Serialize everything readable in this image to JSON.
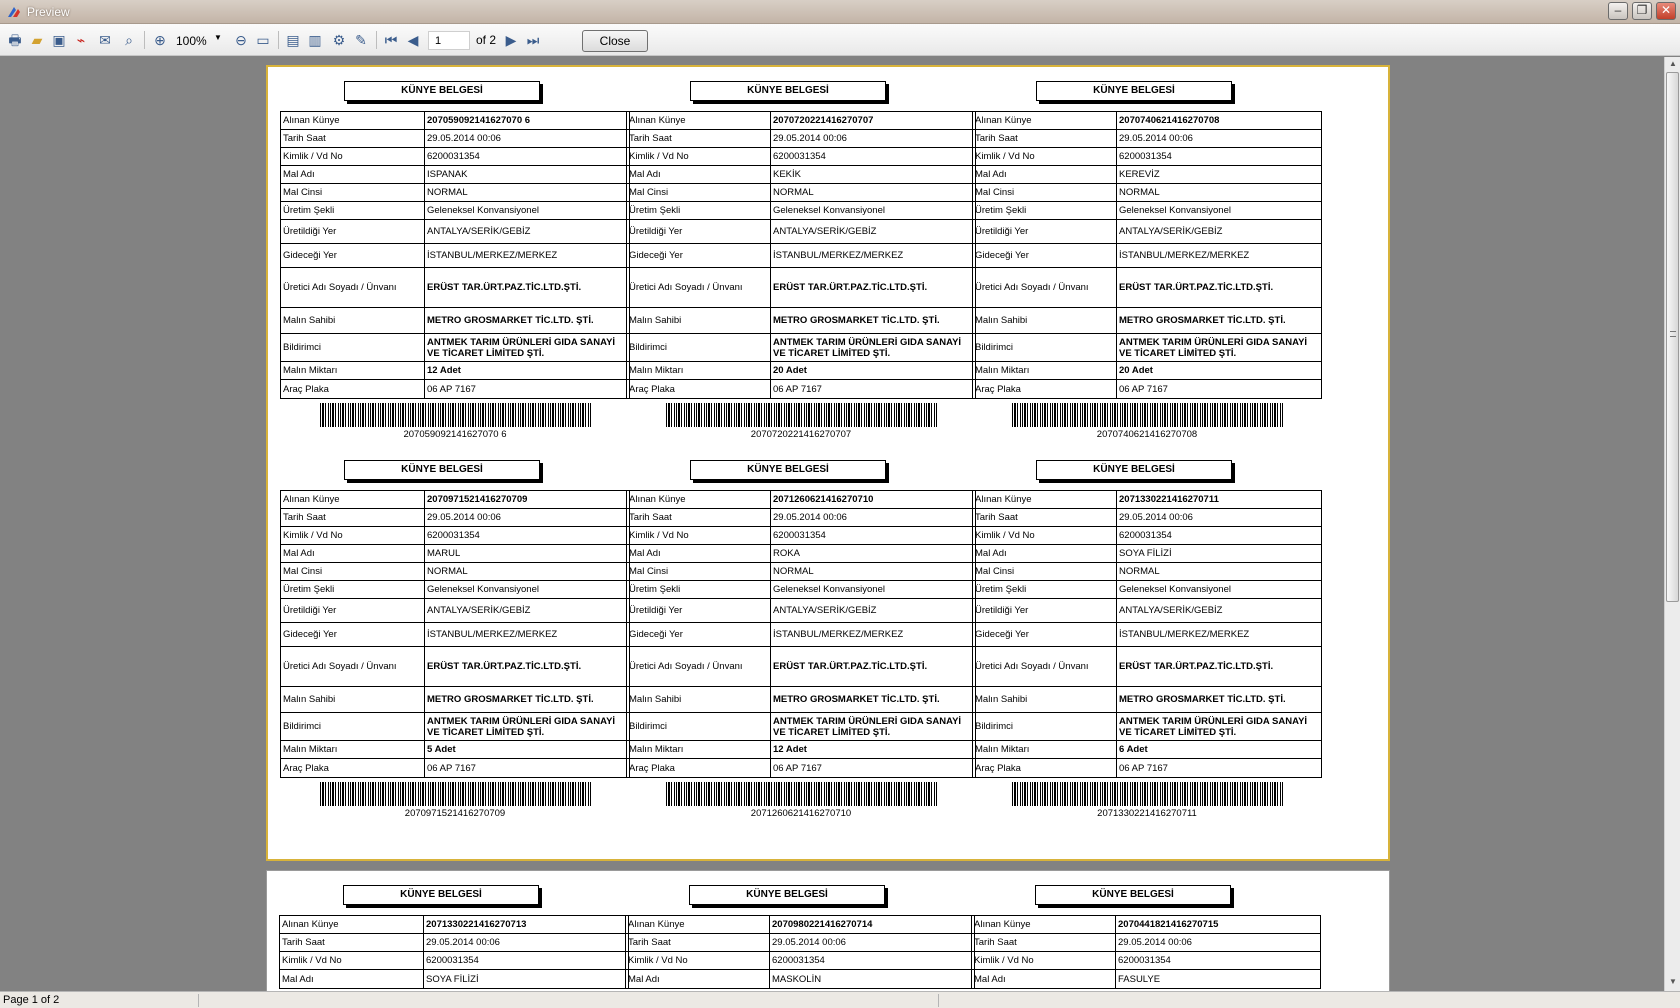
{
  "window": {
    "title": "Preview"
  },
  "toolbar": {
    "zoom": "100%",
    "page_value": "1",
    "page_of": "of 2",
    "close_label": "Close"
  },
  "status": {
    "text": "Page 1 of 2"
  },
  "labels": [
    "Alınan Künye",
    "Tarih Saat",
    "Kimlik / Vd No",
    "Mal Adı",
    "Mal Cinsi",
    "Üretim Şekli",
    "Üretildiği Yer",
    "Gideceği Yer",
    "Üretici Adı Soyadı / Ünvanı",
    "Malın Sahibi",
    "Bildirimci",
    "Malın Miktarı",
    "Araç Plaka"
  ],
  "cards": [
    {
      "header": "KÜNYE BELGESİ",
      "barcode": "207059092141627070 6",
      "values": [
        "207059092141627070 6",
        "29.05.2014 00:06",
        "6200031354",
        "ISPANAK",
        "NORMAL",
        "Geleneksel Konvansiyonel",
        "ANTALYA/SERİK/GEBİZ",
        "İSTANBUL/MERKEZ/MERKEZ",
        "ERÜST TAR.ÜRT.PAZ.TİC.LTD.ŞTİ.",
        "METRO GROSMARKET TİC.LTD. ŞTİ.",
        "ANTMEK TARIM ÜRÜNLERİ GIDA SANAYİ VE TİCARET LİMİTED ŞTİ.",
        "12 Adet",
        "06 AP 7167"
      ]
    },
    {
      "header": "KÜNYE BELGESİ",
      "barcode": "2070720221416270707",
      "values": [
        "2070720221416270707",
        "29.05.2014 00:06",
        "6200031354",
        "KEKİK",
        "NORMAL",
        "Geleneksel Konvansiyonel",
        "ANTALYA/SERİK/GEBİZ",
        "İSTANBUL/MERKEZ/MERKEZ",
        "ERÜST TAR.ÜRT.PAZ.TİC.LTD.ŞTİ.",
        "METRO GROSMARKET TİC.LTD. ŞTİ.",
        "ANTMEK TARIM ÜRÜNLERİ GIDA SANAYİ VE TİCARET LİMİTED ŞTİ.",
        "20 Adet",
        "06 AP 7167"
      ]
    },
    {
      "header": "KÜNYE BELGESİ",
      "barcode": "2070740621416270708",
      "values": [
        "2070740621416270708",
        "29.05.2014 00:06",
        "6200031354",
        "KEREVİZ",
        "NORMAL",
        "Geleneksel Konvansiyonel",
        "ANTALYA/SERİK/GEBİZ",
        "İSTANBUL/MERKEZ/MERKEZ",
        "ERÜST TAR.ÜRT.PAZ.TİC.LTD.ŞTİ.",
        "METRO GROSMARKET TİC.LTD. ŞTİ.",
        "ANTMEK TARIM ÜRÜNLERİ GIDA SANAYİ VE TİCARET LİMİTED ŞTİ.",
        "20 Adet",
        "06 AP 7167"
      ]
    },
    {
      "header": "KÜNYE BELGESİ",
      "barcode": "2070971521416270709",
      "values": [
        "2070971521416270709",
        "29.05.2014 00:06",
        "6200031354",
        "MARUL",
        "NORMAL",
        "Geleneksel Konvansiyonel",
        "ANTALYA/SERİK/GEBİZ",
        "İSTANBUL/MERKEZ/MERKEZ",
        "ERÜST TAR.ÜRT.PAZ.TİC.LTD.ŞTİ.",
        "METRO GROSMARKET TİC.LTD. ŞTİ.",
        "ANTMEK TARIM ÜRÜNLERİ GIDA SANAYİ VE TİCARET LİMİTED ŞTİ.",
        "5 Adet",
        "06 AP 7167"
      ]
    },
    {
      "header": "KÜNYE BELGESİ",
      "barcode": "2071260621416270710",
      "values": [
        "2071260621416270710",
        "29.05.2014 00:06",
        "6200031354",
        "ROKA",
        "NORMAL",
        "Geleneksel Konvansiyonel",
        "ANTALYA/SERİK/GEBİZ",
        "İSTANBUL/MERKEZ/MERKEZ",
        "ERÜST TAR.ÜRT.PAZ.TİC.LTD.ŞTİ.",
        "METRO GROSMARKET TİC.LTD. ŞTİ.",
        "ANTMEK TARIM ÜRÜNLERİ GIDA SANAYİ VE TİCARET LİMİTED ŞTİ.",
        "12 Adet",
        "06 AP 7167"
      ]
    },
    {
      "header": "KÜNYE BELGESİ",
      "barcode": "2071330221416270711",
      "values": [
        "2071330221416270711",
        "29.05.2014 00:06",
        "6200031354",
        "SOYA FİLİZİ",
        "NORMAL",
        "Geleneksel Konvansiyonel",
        "ANTALYA/SERİK/GEBİZ",
        "İSTANBUL/MERKEZ/MERKEZ",
        "ERÜST TAR.ÜRT.PAZ.TİC.LTD.ŞTİ.",
        "METRO GROSMARKET TİC.LTD. ŞTİ.",
        "ANTMEK TARIM ÜRÜNLERİ GIDA SANAYİ VE TİCARET LİMİTED ŞTİ.",
        "6 Adet",
        "06 AP 7167"
      ]
    }
  ],
  "cards_page2": [
    {
      "header": "KÜNYE BELGESİ",
      "values": [
        "2071330221416270713",
        "29.05.2014 00:06",
        "6200031354",
        "SOYA FİLİZİ"
      ]
    },
    {
      "header": "KÜNYE BELGESİ",
      "values": [
        "2070980221416270714",
        "29.05.2014 00:06",
        "6200031354",
        "MASKOLİN"
      ]
    },
    {
      "header": "KÜNYE BELGESİ",
      "values": [
        "2070441821416270715",
        "29.05.2014 00:06",
        "6200031354",
        "FASULYE"
      ]
    }
  ]
}
